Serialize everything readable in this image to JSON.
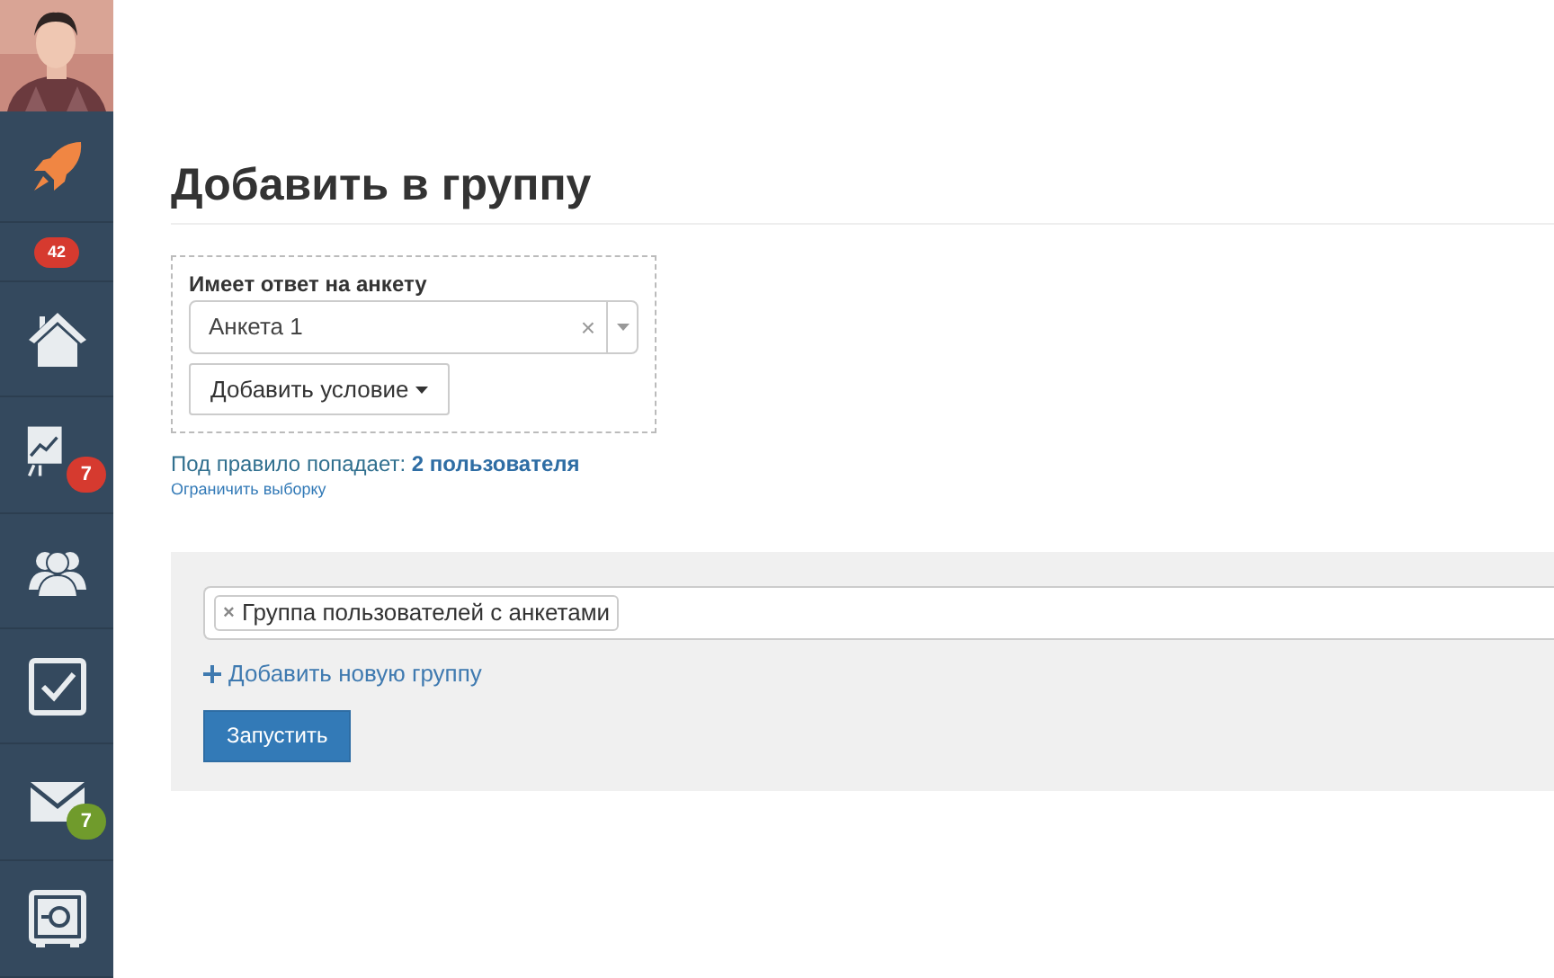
{
  "sidebar": {
    "items": [
      {
        "kind": "rocket"
      },
      {
        "kind": "badge_only",
        "badge": {
          "text": "42",
          "color": "#d63a2f"
        }
      },
      {
        "kind": "home"
      },
      {
        "kind": "chart",
        "badge": {
          "text": "7",
          "color": "#d63a2f"
        }
      },
      {
        "kind": "users"
      },
      {
        "kind": "tasks"
      },
      {
        "kind": "mail",
        "badge": {
          "text": "7",
          "color": "#709b2c"
        }
      },
      {
        "kind": "safe"
      }
    ]
  },
  "page": {
    "title": "Добавить в группу",
    "condition": {
      "label": "Имеет ответ на анкету",
      "select_value": "Анкета 1",
      "clear": "×",
      "add_button": "Добавить условие"
    },
    "match_text": "Под правило попадает: **2 пользователя**",
    "limit_link": "Ограничить выборку",
    "groups": {
      "tags": [
        {
          "remove": "×",
          "label": "Группа пользователей с анкетами"
        }
      ],
      "add_link": "Добавить новую группу",
      "run_button": "Запустить"
    }
  }
}
